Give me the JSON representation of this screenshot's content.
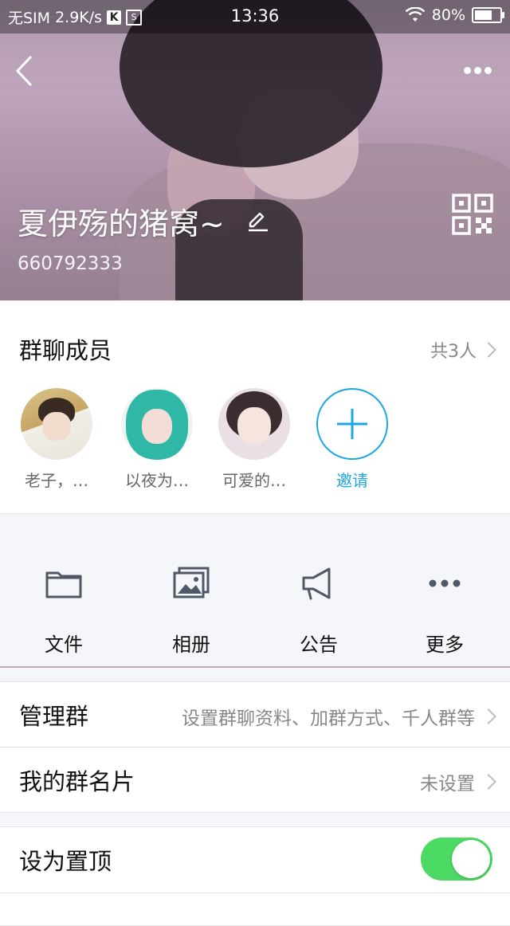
{
  "status_bar": {
    "carrier": "无SIM",
    "speed": "2.9K/s",
    "k_icon_label": "K",
    "s_icon_label": "S",
    "time": "13:36",
    "battery": "80%",
    "battery_level": 0.8
  },
  "header": {
    "group_name": "夏伊殇的猪窝~",
    "group_id": "660792333"
  },
  "members": {
    "title": "群聊成员",
    "count": "共3人",
    "items": [
      {
        "name": "老子，…"
      },
      {
        "name": "以夜为…"
      },
      {
        "name": "可爱的…"
      }
    ],
    "invite_label": "邀请"
  },
  "features": [
    {
      "label": "文件",
      "icon": "folder-icon"
    },
    {
      "label": "相册",
      "icon": "album-icon"
    },
    {
      "label": "公告",
      "icon": "announcement-icon"
    },
    {
      "label": "更多",
      "icon": "more-dots-icon"
    }
  ],
  "rows": {
    "manage": {
      "label": "管理群",
      "value": "设置群聊资料、加群方式、千人群等"
    },
    "card": {
      "label": "我的群名片",
      "value": "未设置"
    },
    "pin": {
      "label": "设为置顶",
      "on": true
    }
  },
  "colors": {
    "accent": "#1ea7e1",
    "toggle_on": "#4cd964"
  }
}
